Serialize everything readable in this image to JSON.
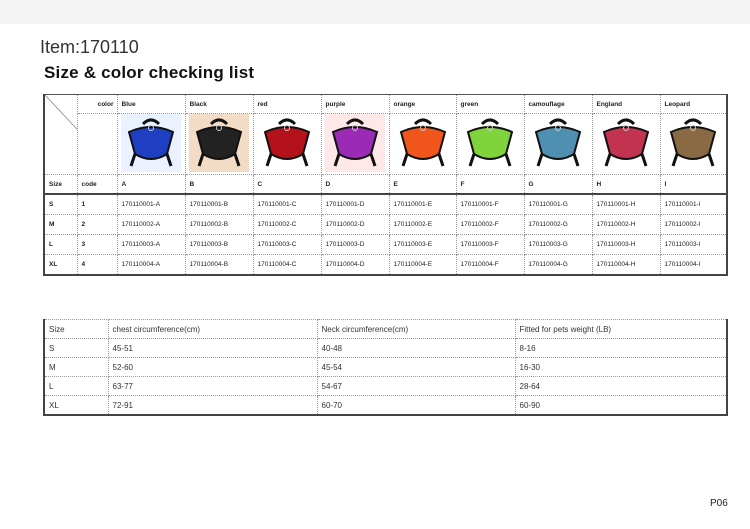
{
  "header": {
    "item": "Item:170110",
    "title": "Size & color checking list"
  },
  "colors": {
    "head_label": "color",
    "items": [
      {
        "name": "Blue",
        "code": "A",
        "fill": "#1f3fc2",
        "bg": "#eaf2ff",
        "skus": [
          "170110001-A",
          "170110002-A",
          "170110003-A",
          "170110004-A"
        ]
      },
      {
        "name": "Black",
        "code": "B",
        "fill": "#222222",
        "bg": "#f3dcc6",
        "skus": [
          "170110001-B",
          "170110002-B",
          "170110003-B",
          "170110004-B"
        ]
      },
      {
        "name": "red",
        "code": "C",
        "fill": "#b3121b",
        "bg": "#ffffff",
        "skus": [
          "170110001-C",
          "170110002-C",
          "170110003-C",
          "170110004-C"
        ]
      },
      {
        "name": "purple",
        "code": "D",
        "fill": "#9b2bb5",
        "bg": "#ffe8e8",
        "skus": [
          "170110001-D",
          "170110002-D",
          "170110003-D",
          "170110004-D"
        ]
      },
      {
        "name": "orange",
        "code": "E",
        "fill": "#f0561b",
        "bg": "#ffffff",
        "skus": [
          "170110001-E",
          "170110002-E",
          "170110003-E",
          "170110004-E"
        ]
      },
      {
        "name": "green",
        "code": "F",
        "fill": "#7fd43b",
        "bg": "#ffffff",
        "skus": [
          "170110001-F",
          "170110002-F",
          "170110003-F",
          "170110004-F"
        ]
      },
      {
        "name": "camouflage",
        "code": "G",
        "fill": "#4f8fb0",
        "bg": "#ffffff",
        "skus": [
          "170110001-G",
          "170110002-G",
          "170110003-G",
          "170110004-G"
        ]
      },
      {
        "name": "England",
        "code": "H",
        "fill": "#c2334f",
        "bg": "#ffffff",
        "skus": [
          "170110001-H",
          "170110002-H",
          "170110003-H",
          "170110004-H"
        ]
      },
      {
        "name": "Leopard",
        "code": "I",
        "fill": "#8a6a45",
        "bg": "#ffffff",
        "skus": [
          "170110001-I",
          "170110002-I",
          "170110003-I",
          "170110004-I"
        ]
      }
    ]
  },
  "size_codes": {
    "size_label": "Size",
    "code_label": "code",
    "rows": [
      {
        "size": "S",
        "code": "1"
      },
      {
        "size": "M",
        "code": "2"
      },
      {
        "size": "L",
        "code": "3"
      },
      {
        "size": "XL",
        "code": "4"
      }
    ]
  },
  "measurements": {
    "headers": [
      "Size",
      "chest circumference(cm)",
      "Neck circumference(cm)",
      "Fitted for pets weight (LB)"
    ],
    "rows": [
      [
        "S",
        "45-51",
        "40-48",
        "8-16"
      ],
      [
        "M",
        "52-60",
        "45-54",
        "16-30"
      ],
      [
        "L",
        "63-77",
        "54-67",
        "28-64"
      ],
      [
        "XL",
        "72-91",
        "60-70",
        "60-90"
      ]
    ]
  },
  "footer": {
    "page": "P06"
  }
}
